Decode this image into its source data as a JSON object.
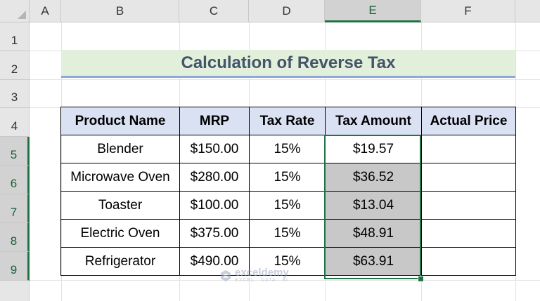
{
  "columns": [
    "A",
    "B",
    "C",
    "D",
    "E",
    "F"
  ],
  "rows": [
    "1",
    "2",
    "3",
    "4",
    "5",
    "6",
    "7",
    "8",
    "9"
  ],
  "title": "Calculation of Reverse Tax",
  "table": {
    "headers": [
      "Product Name",
      "MRP",
      "Tax Rate",
      "Tax Amount",
      "Actual Price"
    ],
    "rows": [
      [
        "Blender",
        "$150.00",
        "15%",
        "$19.57",
        ""
      ],
      [
        "Microwave Oven",
        "$280.00",
        "15%",
        "$36.52",
        ""
      ],
      [
        "Toaster",
        "$100.00",
        "15%",
        "$13.04",
        ""
      ],
      [
        "Electric Oven",
        "$375.00",
        "15%",
        "$48.91",
        ""
      ],
      [
        "Refrigerator",
        "$490.00",
        "15%",
        "$63.91",
        ""
      ]
    ]
  },
  "selection": {
    "column": "E",
    "rows": [
      "5",
      "6",
      "7",
      "8",
      "9"
    ]
  },
  "watermark": {
    "name": "exceldemy",
    "tagline": "EXCEL · DATA · BI"
  },
  "colors": {
    "accent": "#217346",
    "title_bg": "#e2efda",
    "header_bg": "#d9e1f2",
    "shaded": "#c8c8c8"
  }
}
